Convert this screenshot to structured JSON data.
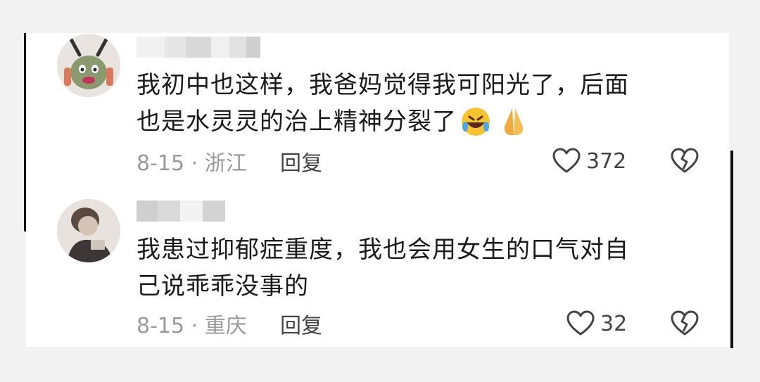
{
  "comments": [
    {
      "text_line1": "我初中也这样，我爸妈觉得我可阳光了，后面",
      "text_line2": "也是水灵灵的治上精神分裂了",
      "emojis": [
        "rolling-on-floor-laughing-emoji",
        "praying-hands-emoji"
      ],
      "date_location": "8-15 · 浙江",
      "reply_label": "回复",
      "likes": "372"
    },
    {
      "text_line1": "我患过抑郁症重度，我也会用女生的口气对自",
      "text_line2": "己说乖乖没事的",
      "date_location": "8-15 · 重庆",
      "reply_label": "回复",
      "likes": "32"
    }
  ],
  "icons": {
    "like": "heart-outline-icon",
    "dislike": "broken-heart-icon"
  },
  "colors": {
    "text": "#1a1a1a",
    "meta": "#9a9a9a",
    "background": "#ffffff"
  }
}
